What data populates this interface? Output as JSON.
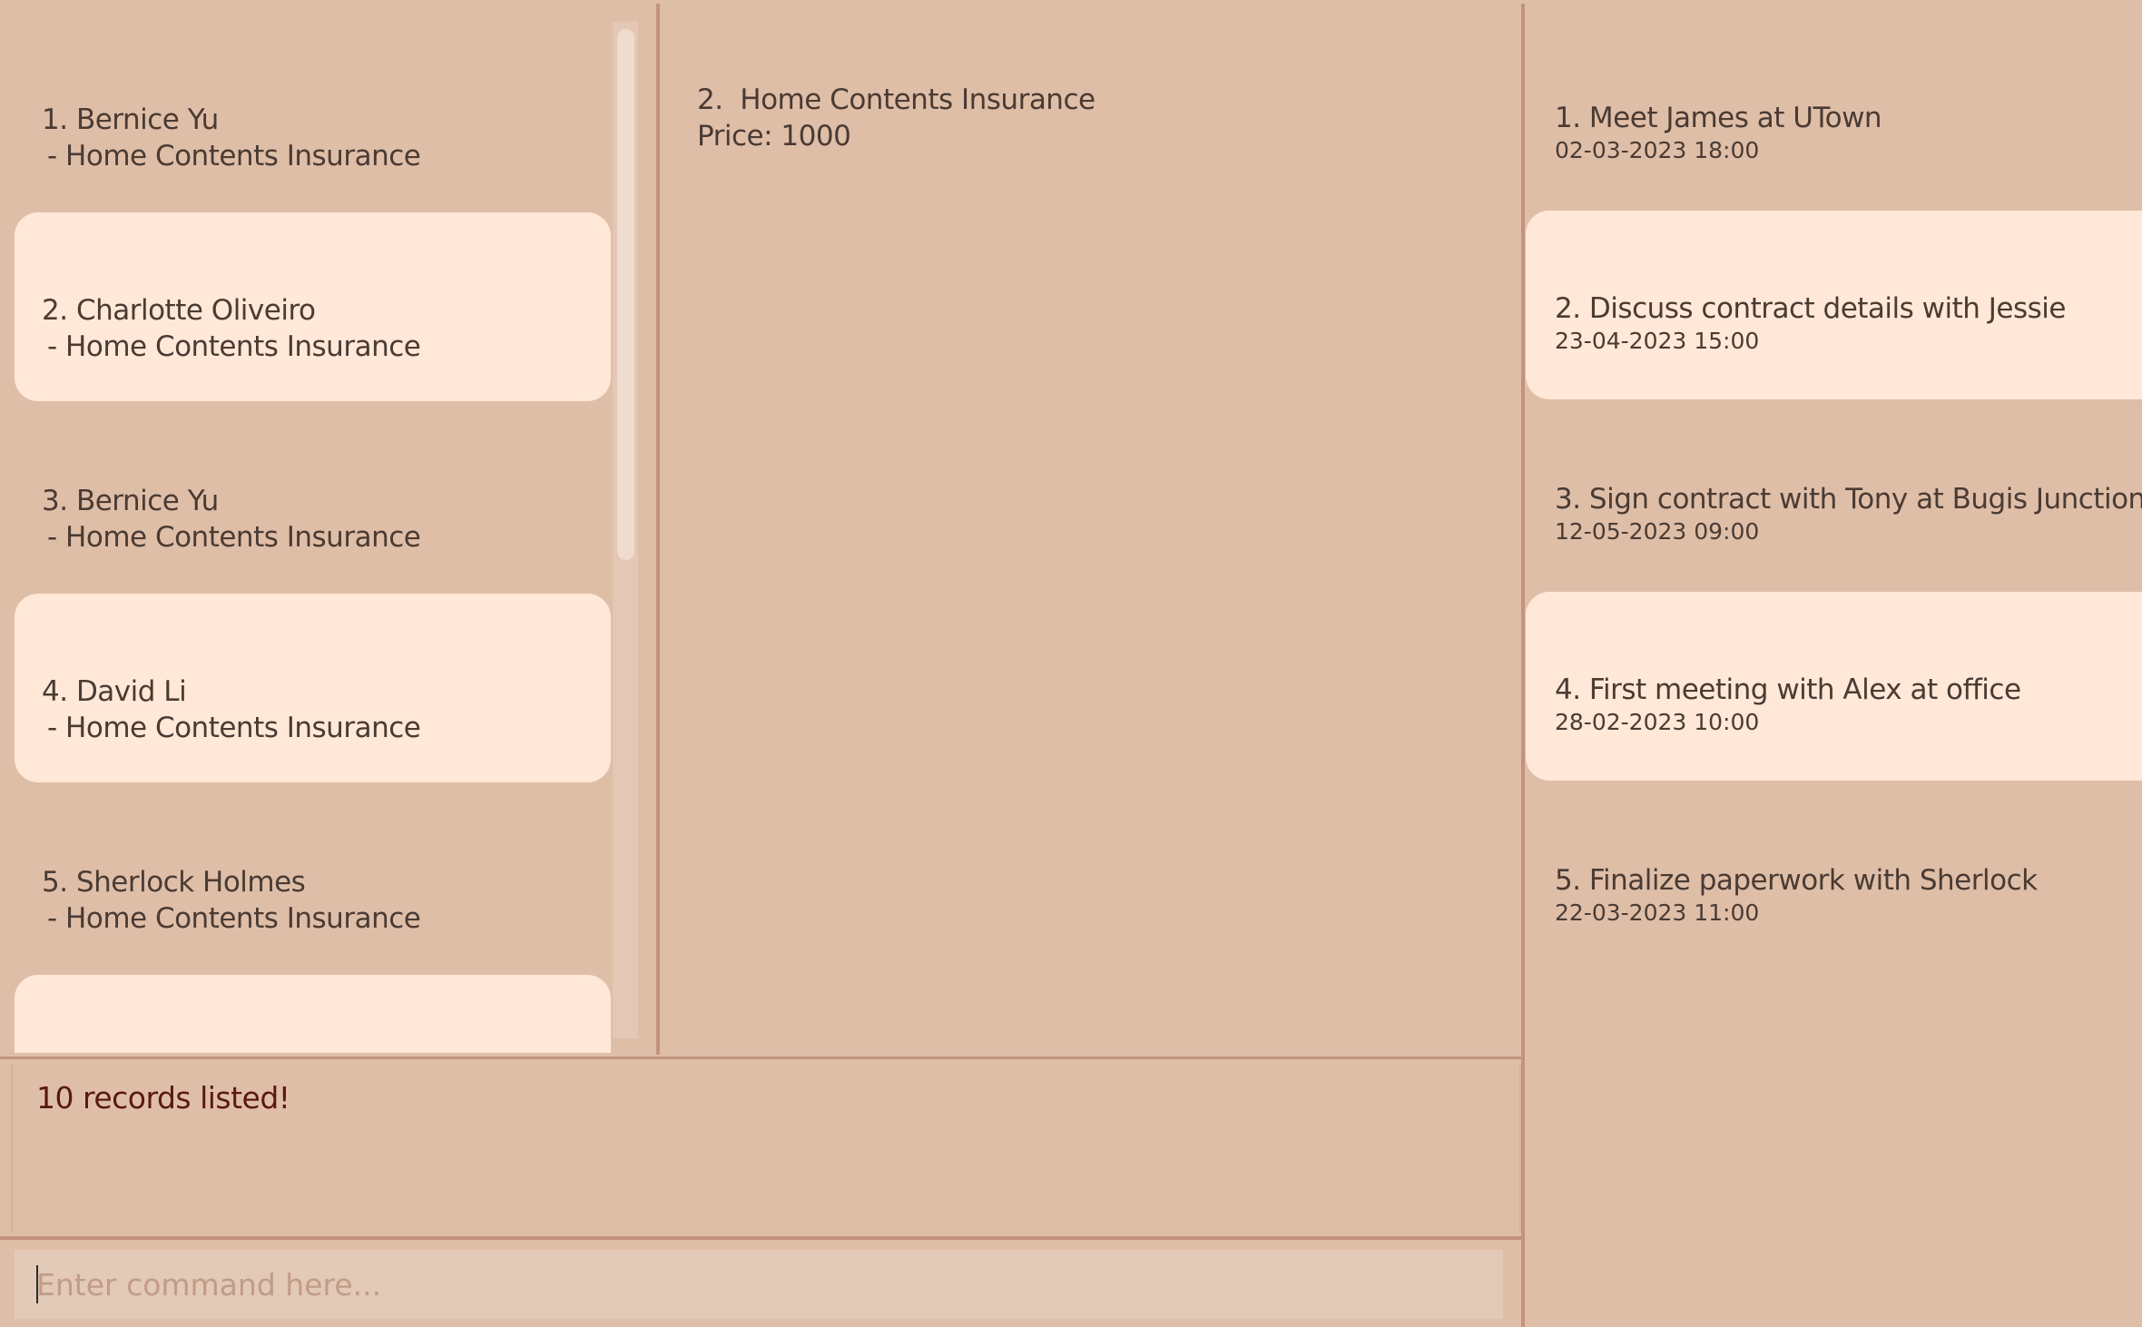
{
  "records": [
    {
      "index": "1.",
      "name": "Bernice Yu",
      "policy": " - Home Contents Insurance"
    },
    {
      "index": "2.",
      "name": "Charlotte Oliveiro",
      "policy": " - Home Contents Insurance"
    },
    {
      "index": "3.",
      "name": "Bernice Yu",
      "policy": " - Home Contents Insurance"
    },
    {
      "index": "4.",
      "name": "David Li",
      "policy": " - Home Contents Insurance"
    },
    {
      "index": "5.",
      "name": "Sherlock Holmes",
      "policy": " - Home Contents Insurance"
    }
  ],
  "detail": {
    "line1": "2.  Home Contents Insurance",
    "line2": "Price: 1000"
  },
  "meetings": [
    {
      "title": "1. Meet James at UTown",
      "time": "02-03-2023 18:00"
    },
    {
      "title": "2. Discuss contract details with Jessie",
      "time": "23-04-2023 15:00"
    },
    {
      "title": "3. Sign contract with Tony at Bugis Junction",
      "time": "12-05-2023 09:00"
    },
    {
      "title": "4. First meeting with Alex at office",
      "time": "28-02-2023 10:00"
    },
    {
      "title": "5. Finalize paperwork with Sherlock",
      "time": "22-03-2023 11:00"
    }
  ],
  "result": {
    "message": "10 records listed!"
  },
  "command": {
    "placeholder": "Enter command here...",
    "value": ""
  },
  "colors": {
    "background": "#dfbea8",
    "card_alt": "#ffe8d7",
    "divider": "#c3937e",
    "result_text": "#5a1a0f"
  }
}
